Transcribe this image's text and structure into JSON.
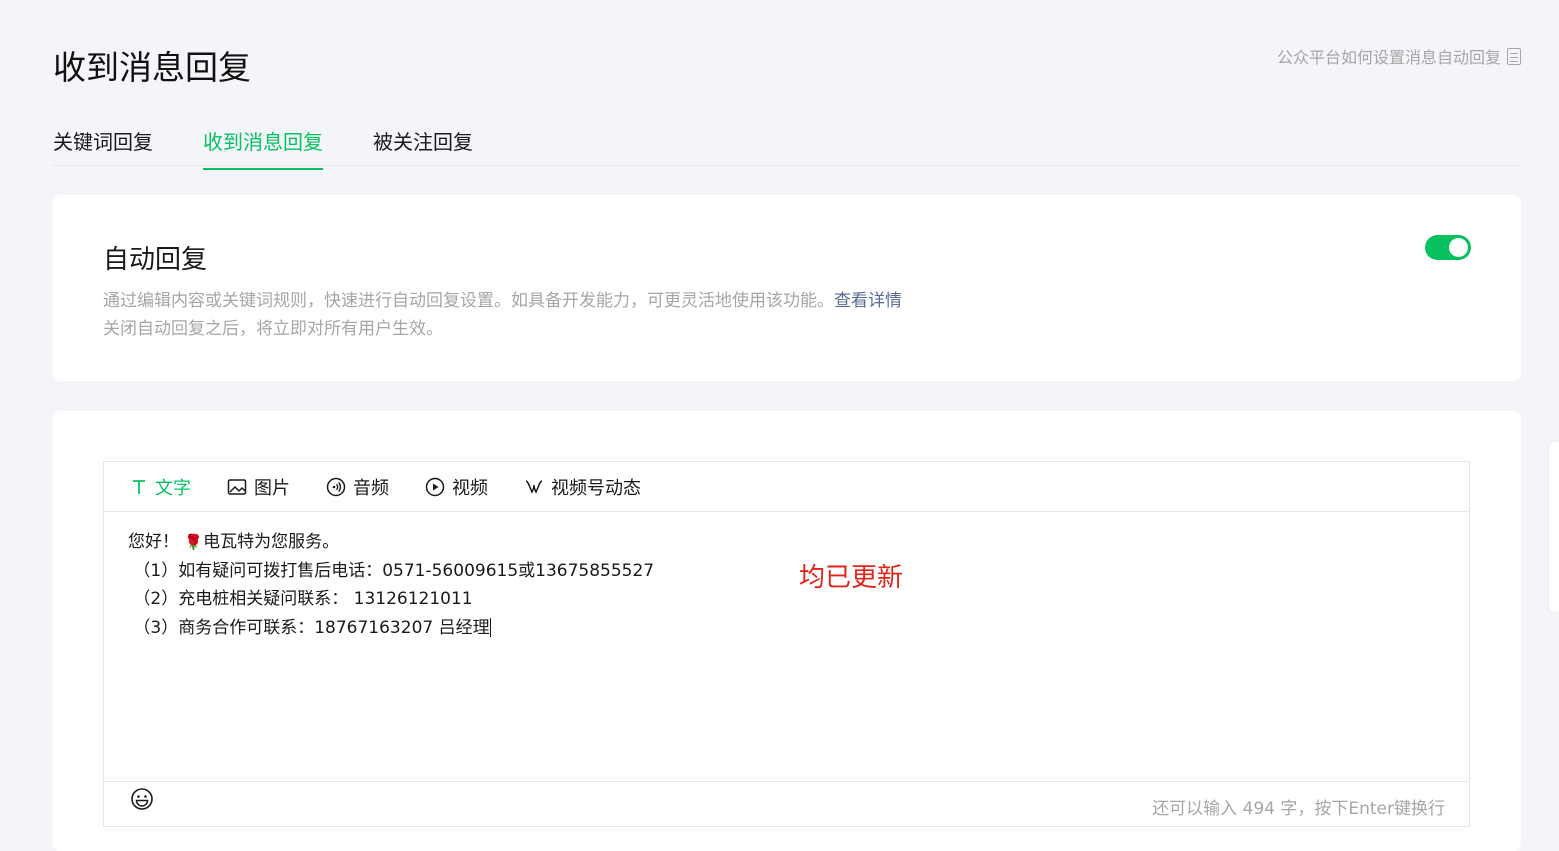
{
  "header": {
    "title": "收到消息回复",
    "help_link": "公众平台如何设置消息自动回复"
  },
  "tabs": [
    {
      "label": "关键词回复",
      "active": false
    },
    {
      "label": "收到消息回复",
      "active": true
    },
    {
      "label": "被关注回复",
      "active": false
    }
  ],
  "auto_reply": {
    "title": "自动回复",
    "desc_line1": "通过编辑内容或关键词规则，快速进行自动回复设置。如具备开发能力，可更灵活地使用该功能。",
    "detail_link": "查看详情",
    "desc_line2": "关闭自动回复之后，将立即对所有用户生效。",
    "enabled": true
  },
  "editor": {
    "toolbar": [
      {
        "label": "文字",
        "icon": "text-icon",
        "active": true
      },
      {
        "label": "图片",
        "icon": "image-icon",
        "active": false
      },
      {
        "label": "音频",
        "icon": "audio-icon",
        "active": false
      },
      {
        "label": "视频",
        "icon": "video-icon",
        "active": false
      },
      {
        "label": "视频号动态",
        "icon": "channels-icon",
        "active": false
      }
    ],
    "content": {
      "line1_a": "您好！",
      "line1_b": "电瓦特为您服务。",
      "line2": " （1）如有疑问可拨打售后电话：0571-56009615或13675855527",
      "line3": " （2）充电桩相关疑问联系： 13126121011",
      "line4": " （3）商务合作可联系：18767163207 吕经理"
    },
    "counter": "还可以输入 494 字，按下Enter键换行"
  },
  "annotation": "均已更新",
  "colors": {
    "accent": "#07c160",
    "link": "#576b95",
    "annotation": "#e0251b",
    "muted": "#a6a6a6"
  }
}
